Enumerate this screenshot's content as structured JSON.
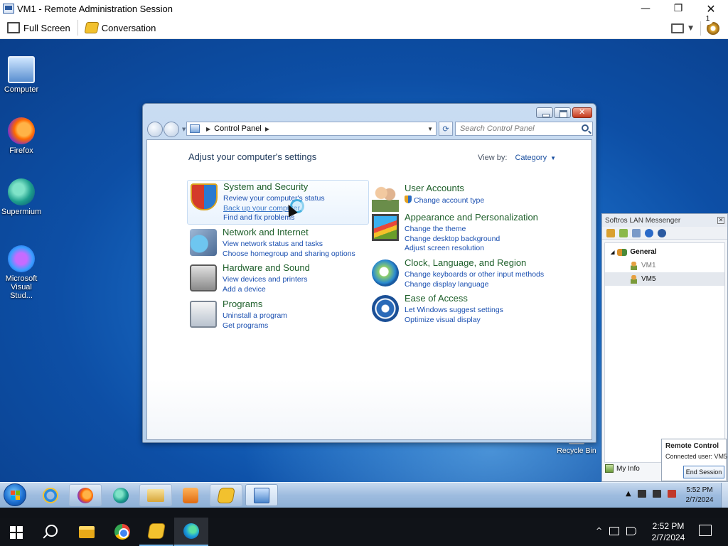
{
  "outer_window": {
    "title": "VM1 - Remote Administration Session",
    "controls": {
      "minimize": "—",
      "restore": "❐",
      "close": "✕"
    }
  },
  "toolbar": {
    "full_screen_label": "Full Screen",
    "conversation_label": "Conversation"
  },
  "desktop_icons": [
    {
      "label": "Computer",
      "icon": "computer-icon"
    },
    {
      "label": "Firefox",
      "icon": "firefox-icon"
    },
    {
      "label": "Supermium",
      "icon": "supermium-icon"
    },
    {
      "label": "Microsoft Visual Stud...",
      "icon": "visual-studio-icon"
    }
  ],
  "recycle_bin_label": "Recycle Bin",
  "control_panel": {
    "address": "Control Panel",
    "search_placeholder": "Search Control Panel",
    "heading": "Adjust your computer's settings",
    "view_by_label": "View by:",
    "view_by_value": "Category",
    "categories": [
      {
        "title": "System and Security",
        "icon": "security-shield-icon",
        "links": [
          "Review your computer's status",
          "Back up your computer",
          "Find and fix problems"
        ]
      },
      {
        "title": "Network and Internet",
        "icon": "network-globe-icon",
        "links": [
          "View network status and tasks",
          "Choose homegroup and sharing options"
        ]
      },
      {
        "title": "Hardware and Sound",
        "icon": "printer-icon",
        "links": [
          "View devices and printers",
          "Add a device"
        ]
      },
      {
        "title": "Programs",
        "icon": "programs-icon",
        "links": [
          "Uninstall a program",
          "Get programs"
        ]
      },
      {
        "title": "User Accounts",
        "icon": "users-icon",
        "links": [
          "Change account type"
        ]
      },
      {
        "title": "Appearance and Personalization",
        "icon": "monitor-paint-icon",
        "links": [
          "Change the theme",
          "Change desktop background",
          "Adjust screen resolution"
        ]
      },
      {
        "title": "Clock, Language, and Region",
        "icon": "clock-globe-icon",
        "links": [
          "Change keyboards or other input methods",
          "Change display language"
        ]
      },
      {
        "title": "Ease of Access",
        "icon": "ease-of-access-icon",
        "links": [
          "Let Windows suggest settings",
          "Optimize visual display"
        ]
      }
    ]
  },
  "lan_messenger": {
    "title": "Softros LAN Messenger",
    "group": "General",
    "users": [
      "VM1",
      "VM5"
    ],
    "selected_user": "VM5",
    "my_info_label": "My Info"
  },
  "remote_control_popup": {
    "title": "Remote Control",
    "connected_user": "Connected user:  VM5",
    "end_session_label": "End Session"
  },
  "remote_taskbar": {
    "time": "5:52 PM",
    "date": "2/7/2024"
  },
  "host_taskbar": {
    "time": "2:52 PM",
    "date": "2/7/2024",
    "notification_count": "1"
  }
}
